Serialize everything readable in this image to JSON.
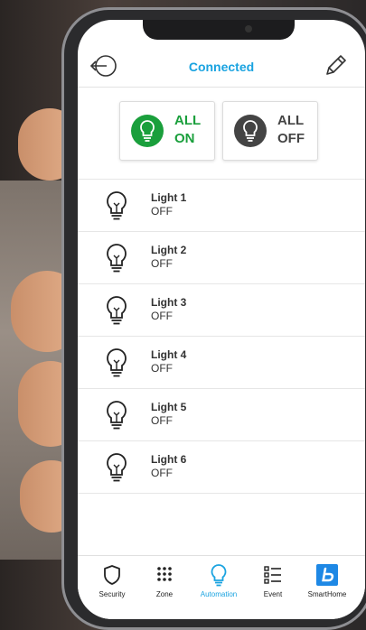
{
  "header": {
    "title": "Connected"
  },
  "quick_actions": {
    "all_on": {
      "line1": "ALL",
      "line2": "ON",
      "color": "#1a9f3c"
    },
    "all_off": {
      "line1": "ALL",
      "line2": "OFF",
      "color": "#444444"
    }
  },
  "lights": [
    {
      "name": "Light 1",
      "state": "OFF"
    },
    {
      "name": "Light 2",
      "state": "OFF"
    },
    {
      "name": "Light 3",
      "state": "OFF"
    },
    {
      "name": "Light 4",
      "state": "OFF"
    },
    {
      "name": "Light 5",
      "state": "OFF"
    },
    {
      "name": "Light 6",
      "state": "OFF"
    }
  ],
  "tabs": [
    {
      "label": "Security",
      "icon": "shield-icon"
    },
    {
      "label": "Zone",
      "icon": "grid-icon"
    },
    {
      "label": "Automation",
      "icon": "bulb-icon",
      "active": true
    },
    {
      "label": "Event",
      "icon": "list-icon"
    },
    {
      "label": "SmartHome",
      "icon": "smarthome-logo-icon"
    }
  ],
  "colors": {
    "accent": "#1aa3e0",
    "on_green": "#1a9f3c",
    "off_gray": "#444444"
  }
}
